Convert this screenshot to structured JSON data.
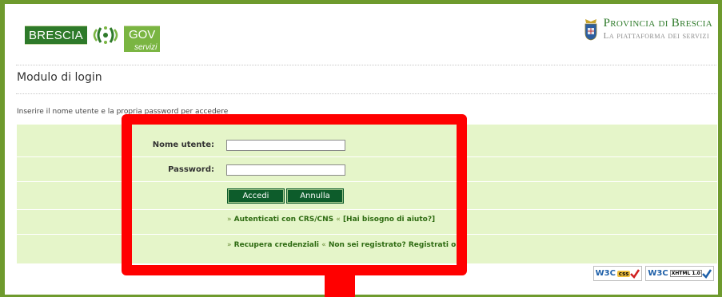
{
  "header": {
    "logo_left": {
      "brescia": "BRESCIA",
      "gov": "GOV",
      "servizi": "servizi"
    },
    "logo_right": {
      "title": "Provincia di Brescia",
      "subtitle": "La piattaforma dei servizi"
    }
  },
  "page": {
    "title": "Modulo di login",
    "intro": "Inserire il nome utente e la propria password per accedere"
  },
  "form": {
    "username": {
      "label": "Nome utente:",
      "value": ""
    },
    "password": {
      "label": "Password:",
      "value": ""
    },
    "buttons": {
      "submit": "Accedi",
      "cancel": "Annulla"
    },
    "links": {
      "crs_prefix": "»",
      "crs_link": "Autenticati con CRS/CNS",
      "crs_suffix": "«",
      "help_link": "[Hai bisogno di aiuto?]",
      "recover_prefix": "»",
      "recover_link": "Recupera credenziali",
      "recover_suffix": "«",
      "register_link": "Non sei registrato? Registrati ora"
    }
  },
  "badges": {
    "css": {
      "w3c": "W3C",
      "kind": "css"
    },
    "xhtml": {
      "w3c": "W3C",
      "kind": "XHTML 1.0"
    }
  },
  "colors": {
    "frame": "#6e9a2d",
    "panel": "#e5f5c9",
    "button": "#0d5c2b",
    "link": "#2e6b12",
    "annotation": "#ff0000"
  }
}
